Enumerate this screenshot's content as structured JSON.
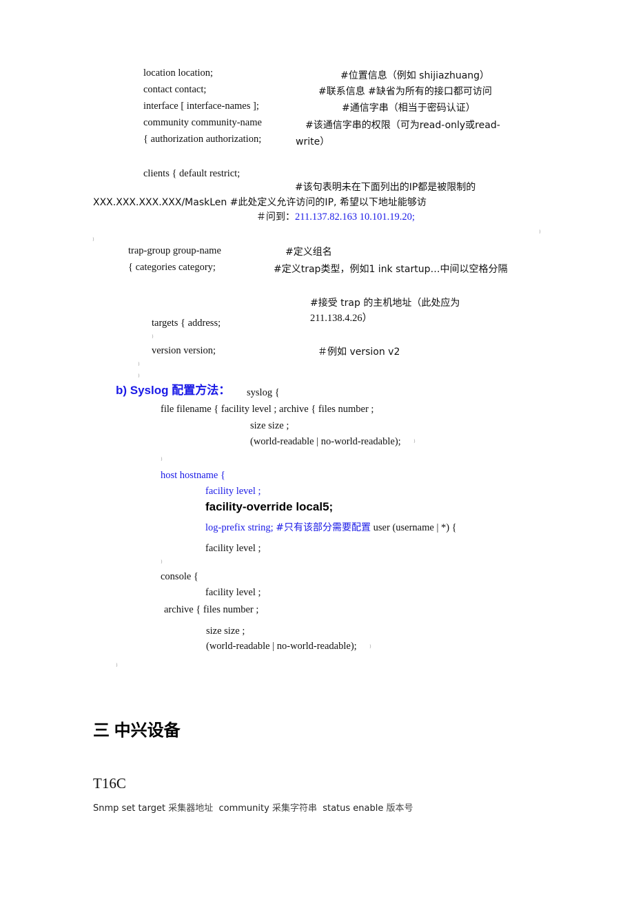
{
  "snmp_block": {
    "lines": [
      {
        "code": "location location;",
        "comment": "#位置信息（例如  shijiazhuang）"
      },
      {
        "code": "contact contact;",
        "comment": "#联系信息  #缺省为所有的接口都可访问"
      },
      {
        "code": "interface [ interface-names ];",
        "comment": "#通信字串（相当于密码认证）"
      },
      {
        "code": "community community-name",
        "comment": "#该通信字串的权限（可为read-only或read-"
      },
      {
        "code": "{ authorization authorization;",
        "comment": "write）"
      }
    ],
    "clients": {
      "code": "clients { default restrict;",
      "comment1": "#该句表明未在下面列出的IP都是被限制的",
      "mask_line": "XXX.XXX.XXX.XXX/MaskLen #此处定义允许访问的IP, 希望以下地址能够访",
      "comment2_prefix": "＃问到：",
      "ips": "211.137.82.163 10.101.19.20;"
    },
    "brace": "}"
  },
  "trap_group": {
    "name_line": {
      "code": "trap-group group-name",
      "comment": "#定义组名"
    },
    "categories_line": {
      "code": "{ categories category;",
      "comment": "#定义trap类型，例如1 ink startup…中间以空格分隔"
    },
    "targets_comment1": "#接受  trap 的主机地址（此处应为",
    "targets_comment2": "211.138.4.26）",
    "targets_code": "targets { address;",
    "version_code": "version version;",
    "version_comment": "＃例如  version v2"
  },
  "syslog": {
    "heading": "b) Syslog 配置方法：",
    "open": "syslog {",
    "file_line": "file filename { facility level ; archive { files number ;",
    "size_line": "size size ;",
    "readable_line": "(world-readable | no-world-readable);",
    "host_open": "host hostname {",
    "host_facility": "facility level ;",
    "facility_override": "facility-override local5;",
    "log_prefix": "log-prefix string;",
    "log_prefix_comment": "#只有该部分需要配置",
    "user_line": "user (username | *) {",
    "user_facility": "facility level ;",
    "console_open": "console {",
    "console_facility": "facility level ;",
    "archive_line": "archive { files number ;",
    "archive_size": "size size ;",
    "archive_readable": "(world-readable | no-world-readable);"
  },
  "section3": {
    "title": "三  中兴设备",
    "device": "T16C",
    "snmp_parts": [
      {
        "text": "Snmp set target ",
        "cjk": false
      },
      {
        "text": "采集器地址",
        "cjk": true
      },
      {
        "text": "  community ",
        "cjk": false
      },
      {
        "text": "采集字符串",
        "cjk": true
      },
      {
        "text": "  status enable ",
        "cjk": false
      },
      {
        "text": "版本号",
        "cjk": true
      }
    ]
  },
  "colors": {
    "accent_blue": "#1a1ae6",
    "text": "#111111"
  }
}
